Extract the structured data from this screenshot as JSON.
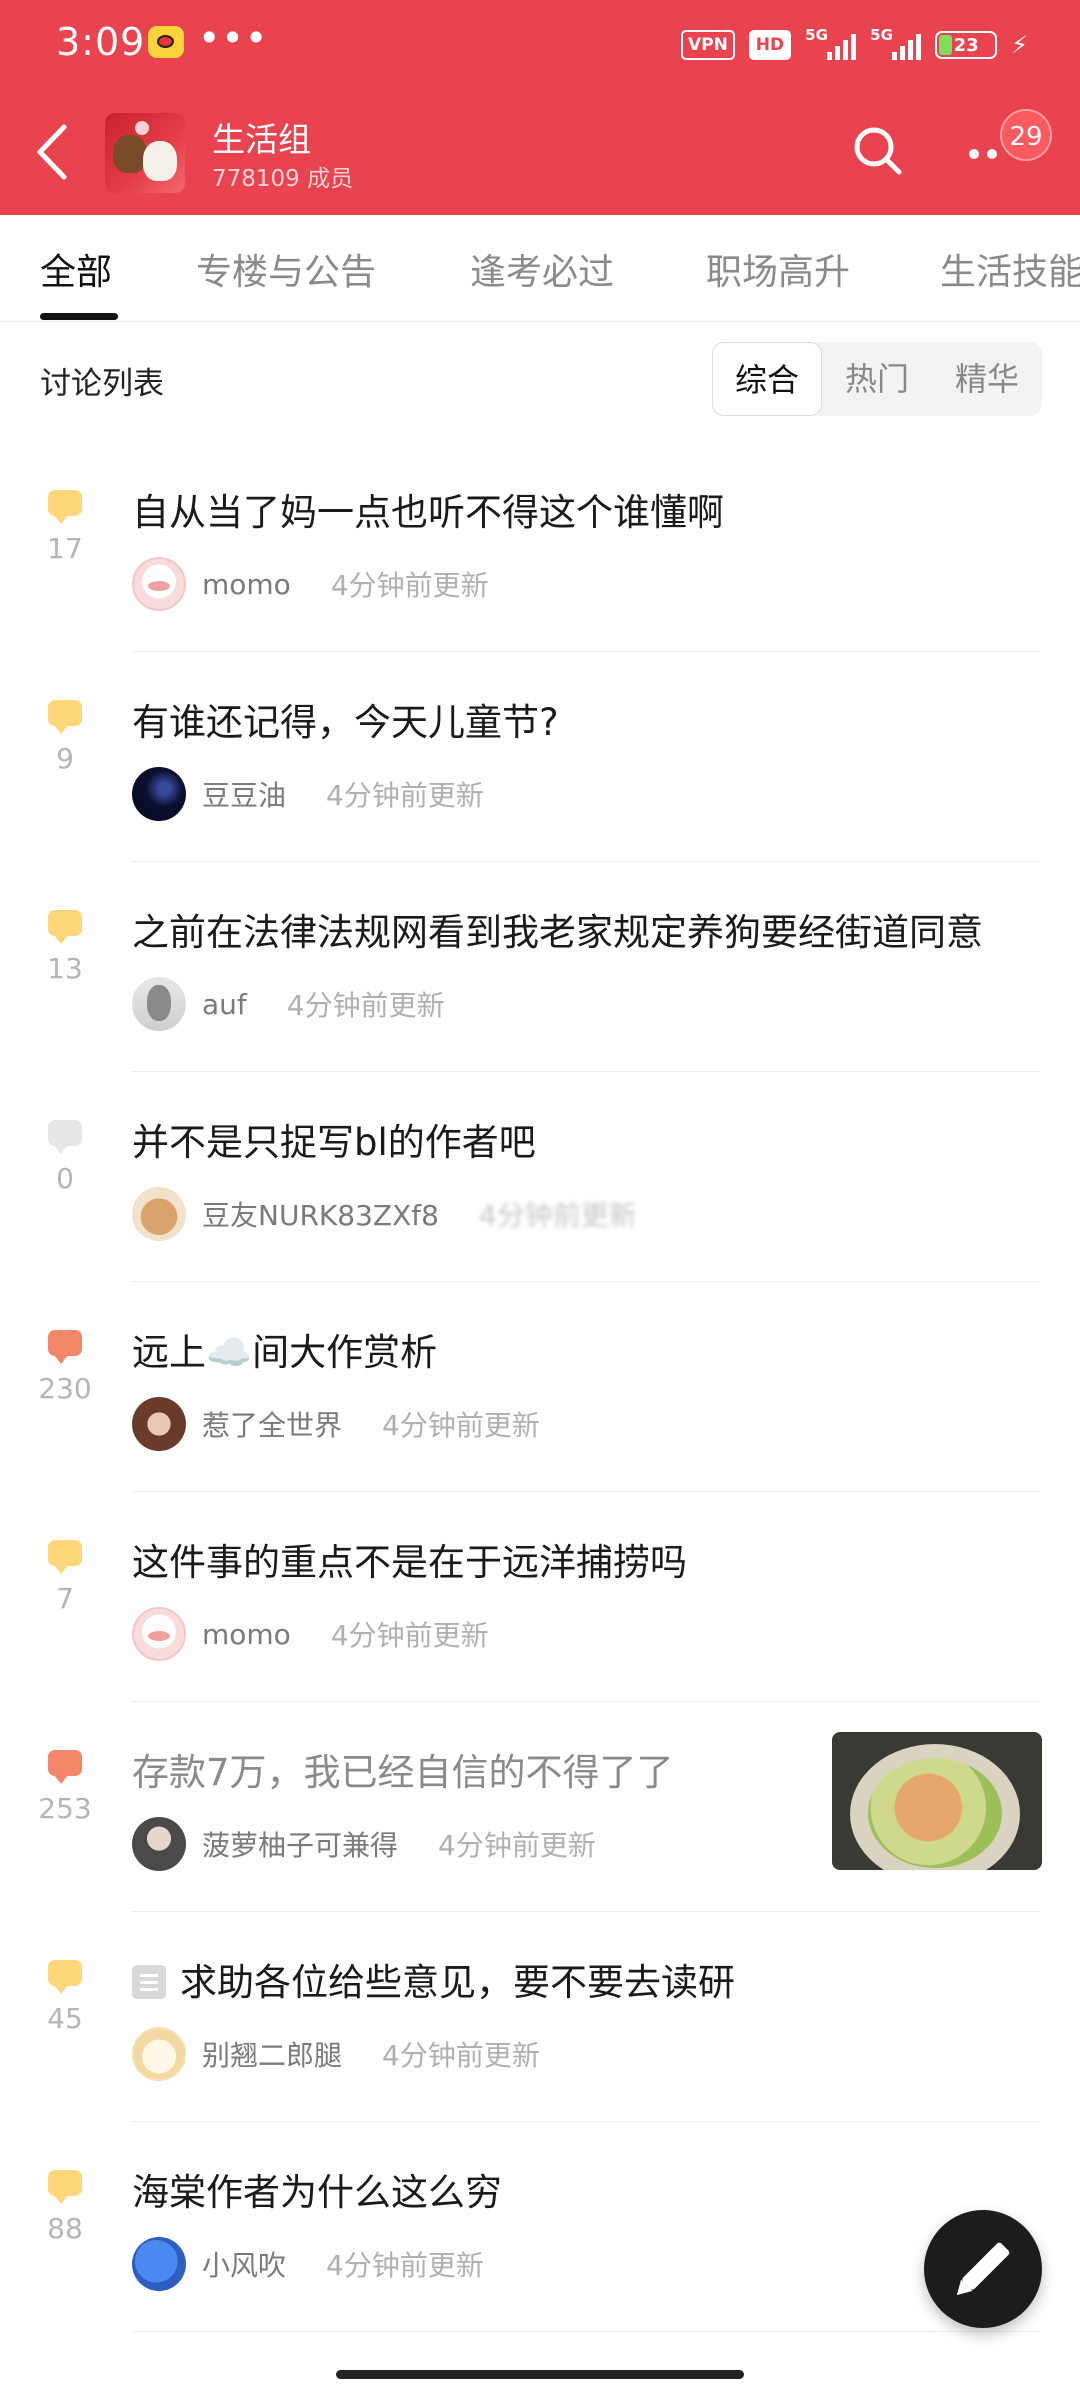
{
  "status_bar": {
    "time": "3:09",
    "dots": "•••",
    "vpn": "VPN",
    "hd": "HD",
    "net1": "5G",
    "net2": "5G",
    "battery": "23"
  },
  "header": {
    "group_name": "生活组",
    "members": "778109 成员",
    "badge": "29"
  },
  "tabs": [
    {
      "label": "全部",
      "active": true
    },
    {
      "label": "专楼与公告"
    },
    {
      "label": "逢考必过"
    },
    {
      "label": "职场高升"
    },
    {
      "label": "生活技能"
    }
  ],
  "section": {
    "title": "讨论列表",
    "filters": [
      "综合",
      "热门",
      "精华"
    ],
    "selected_filter": "综合"
  },
  "posts": [
    {
      "title": "自从当了妈一点也听不得这个谁懂啊",
      "count": "17",
      "author": "momo",
      "time": "4分钟前更新",
      "bubble": "yellow",
      "avatar": "av-momo"
    },
    {
      "title": "有谁还记得，今天儿童节?",
      "count": "9",
      "author": "豆豆油",
      "time": "4分钟前更新",
      "bubble": "yellow",
      "avatar": "av-dou"
    },
    {
      "title": "之前在法律法规网看到我老家规定养狗要经街道同意",
      "count": "13",
      "author": "auf",
      "time": "4分钟前更新",
      "bubble": "yellow",
      "avatar": "av-auf"
    },
    {
      "title": "并不是只捉写bl的作者吧",
      "count": "0",
      "author": "豆友NURK83ZXf8",
      "time": "4分钟前更新",
      "bubble": "gray",
      "avatar": "av-nurk"
    },
    {
      "title": "远上☁️间大作赏析",
      "count": "230",
      "author": "惹了全世界",
      "time": "4分钟前更新",
      "bubble": "orange",
      "avatar": "av-re"
    },
    {
      "title": "这件事的重点不是在于远洋捕捞吗",
      "count": "7",
      "author": "momo",
      "time": "4分钟前更新",
      "bubble": "yellow",
      "avatar": "av-momo"
    },
    {
      "title": "存款7万，我已经自信的不得了了",
      "count": "253",
      "author": "菠萝柚子可兼得",
      "time": "4分钟前更新",
      "bubble": "orange",
      "avatar": "av-bolo"
    },
    {
      "title": "求助各位给些意见，要不要去读研",
      "count": "45",
      "author": "别翘二郎腿",
      "time": "4分钟前更新",
      "bubble": "yellow",
      "avatar": "av-bie"
    },
    {
      "title": "海棠作者为什么这么穷",
      "count": "88",
      "author": "小风吹",
      "time": "4分钟前更新",
      "bubble": "yellow",
      "avatar": "av-xiao"
    }
  ],
  "icons": {
    "back": "back-arrow-icon",
    "search": "search-icon",
    "more": "more-dots-icon",
    "compose": "pen-icon"
  },
  "colors": {
    "header_red": "#e8434e",
    "bubble_yellow": "#ffd67a",
    "bubble_orange": "#f4876a"
  }
}
